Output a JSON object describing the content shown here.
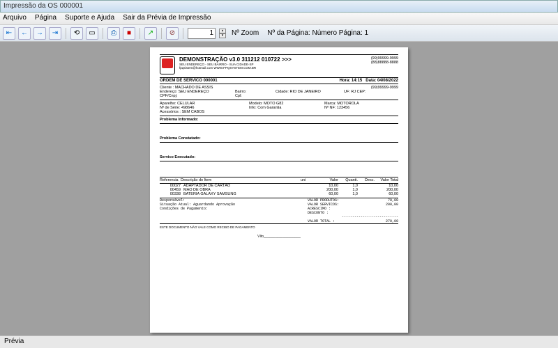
{
  "window": {
    "title": "Impressão da OS 000001"
  },
  "menu": {
    "arquivo": "Arquivo",
    "pagina": "Página",
    "suporte": "Suporte e Ajuda",
    "sair": "Sair da Prévia de Impressão"
  },
  "toolbar": {
    "zoom_value": "1",
    "zoom_label": "Nº Zoom",
    "page_label": "Nº da Página: Número Página: 1"
  },
  "doc": {
    "header": {
      "title": "DEMONSTRAÇÃO v3.0 311212 010722 >>>",
      "sub1": "SEU ENDEREÇO - SEU BAIRRO - SUA CIDADE-SP",
      "sub2": "fpqsistem@hotmail.com  WWW.FPQSYSTEM.COM.BR",
      "phone1": "(99)99999-9999",
      "phone2": "(88)88888-8888"
    },
    "os": {
      "title": "ORDEM DE SERVICO 000001",
      "hora_lab": "Hora:",
      "hora": "14:15",
      "data_lab": "Data:",
      "data": "04/08/2022"
    },
    "cliente": {
      "l1a": "Cliente : MACHADO DE ASSIS",
      "l1b": "(99)99999-9999",
      "l2a": "Endereço: SEU ENDEREÇO",
      "l2b": "Bairro:",
      "l2c": "Cidade: RIO DE JANEIRO",
      "l2d": "UF: RJ  CEP:",
      "l3a": "CPF/Cnpj:",
      "l3b": "Cpl:"
    },
    "aparelho": {
      "l1a": "Aparelho: CELULAR",
      "l1b": "Modelo: MOTO G82",
      "l1c": "Marca: MOTOROLA",
      "l2a": "Nº de Série: 498646",
      "l2b": "Info: Com Garantia",
      "l2c": "Nº NF: 123456",
      "l3": "Acessórios  :  SEM CABOS"
    },
    "labels": {
      "informado": "Problema Informado:",
      "constatado": "Problema Constatado:",
      "executado": "Servico Executado:"
    },
    "cols": {
      "ref": "Referencia",
      "desc": "Descrição do Item",
      "uni": "uni",
      "valor": "Valor",
      "quant": "Quanti.",
      "desc2": "Desc.",
      "total": "Valor Total"
    },
    "items": [
      {
        "ref": "00027",
        "desc": "ADAPTADOR DE CARTÃO",
        "valor": "10,00",
        "q": "1,0",
        "tot": "10,00"
      },
      {
        "ref": "00459",
        "desc": "MAO DE OBRA",
        "valor": "200,00",
        "q": "1,0",
        "tot": "200,00"
      },
      {
        "ref": "00338",
        "desc": "BATERIA GALAXY SAMSUNG",
        "valor": "60,00",
        "q": "1,0",
        "tot": "60,00"
      }
    ],
    "footer_left": {
      "resp": "Responsável:",
      "sit": "Situação Atual: Aguardando Aprovação",
      "cond": "Condições de Pagamento:"
    },
    "totals": {
      "prod_l": "VALOR PRODUTOS:",
      "prod_v": "70,00",
      "serv_l": "VALOR SERVICOS:",
      "serv_v": "200,00",
      "acr_l": "ACRESCIMO    :",
      "acr_v": "",
      "desc_l": "DESCONTO     :",
      "desc_v": "",
      "sep": "---------------------------",
      "tot_l": "VALOR TOTAL :",
      "tot_v": "270,00"
    },
    "fine": "ESTE DOCUMENTO NÃO VALE COMO RECIBO DE PAGAMENTO",
    "sign": "Víto___________________"
  },
  "status": {
    "text": "Prévia"
  }
}
